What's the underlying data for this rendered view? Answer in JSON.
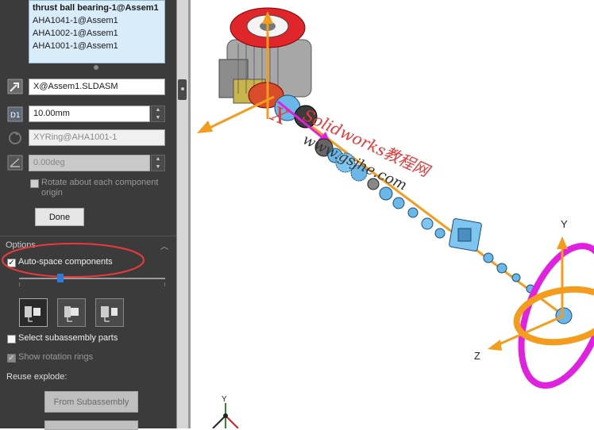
{
  "selection_list": {
    "items": [
      "thrust ball bearing-1@Assem1",
      "AHA1041-1@Assem1",
      "AHA1002-1@Assem1",
      "AHA1001-1@Assem1"
    ]
  },
  "direction_field": {
    "value": "X@Assem1.SLDASM"
  },
  "distance_field": {
    "value": "10.00mm"
  },
  "rotation_axis_field": {
    "value": "XYRing@AHA1001-1"
  },
  "angle_field": {
    "value": "0.00deg"
  },
  "rotate_each_label": "Rotate about each component origin",
  "done_button": "Done",
  "options": {
    "title": "Options",
    "auto_space_label": "Auto-space components",
    "auto_space_checked": true,
    "select_subassembly_label": "Select subassembly parts",
    "show_rotation_rings_label": "Show rotation rings",
    "reuse_explode_label": "Reuse explode:",
    "from_subassembly_button": "From Subassembly"
  },
  "viewport": {
    "axis_labels": {
      "y": "Y",
      "z": "Z"
    },
    "watermark_text": "Solidworks教程网",
    "watermark_url": "www.gsjhe.com",
    "triad_y_label": "Y",
    "colors": {
      "arrow": "#f39c1e",
      "ring": "#e022e0",
      "part_blue": "#6ab7e8",
      "motor_red": "#e0262a",
      "annotation": "#e83a3a"
    }
  }
}
